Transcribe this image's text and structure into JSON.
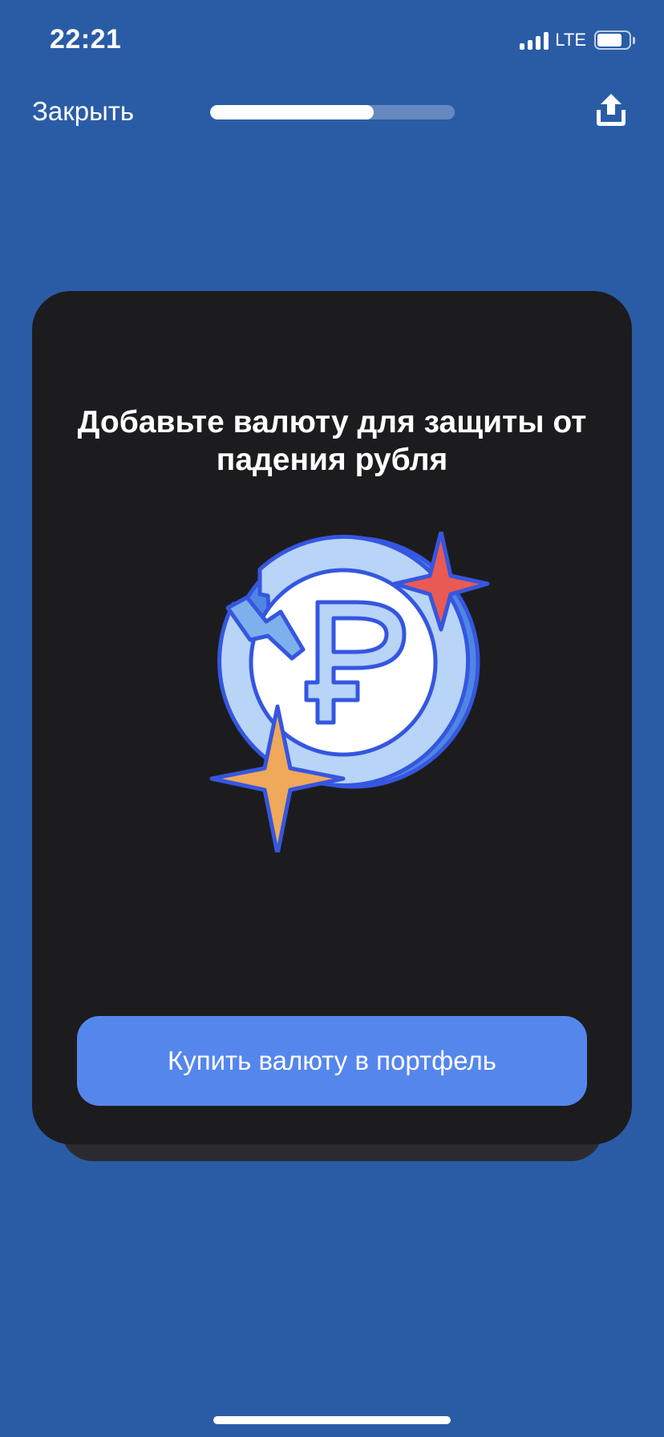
{
  "status_bar": {
    "time": "22:21",
    "network": "LTE",
    "signal_bars": 4,
    "battery_level": 0.8
  },
  "header": {
    "close_label": "Закрыть",
    "progress": 0.67,
    "share_icon": "share-upload-icon"
  },
  "card": {
    "title": "Добавьте валюту для защиты от падения рубля",
    "illustration": "ruble-coin-with-sparkles",
    "cta_label": "Купить валюту в портфель"
  },
  "colors": {
    "background": "#2a5ca6",
    "card": "#1c1c1e",
    "button": "#5586ec",
    "coin_light": "#b8d4f7",
    "coin_outline": "#3556e0",
    "sparkle_red": "#eb5a52",
    "sparkle_orange": "#f0a85a"
  }
}
